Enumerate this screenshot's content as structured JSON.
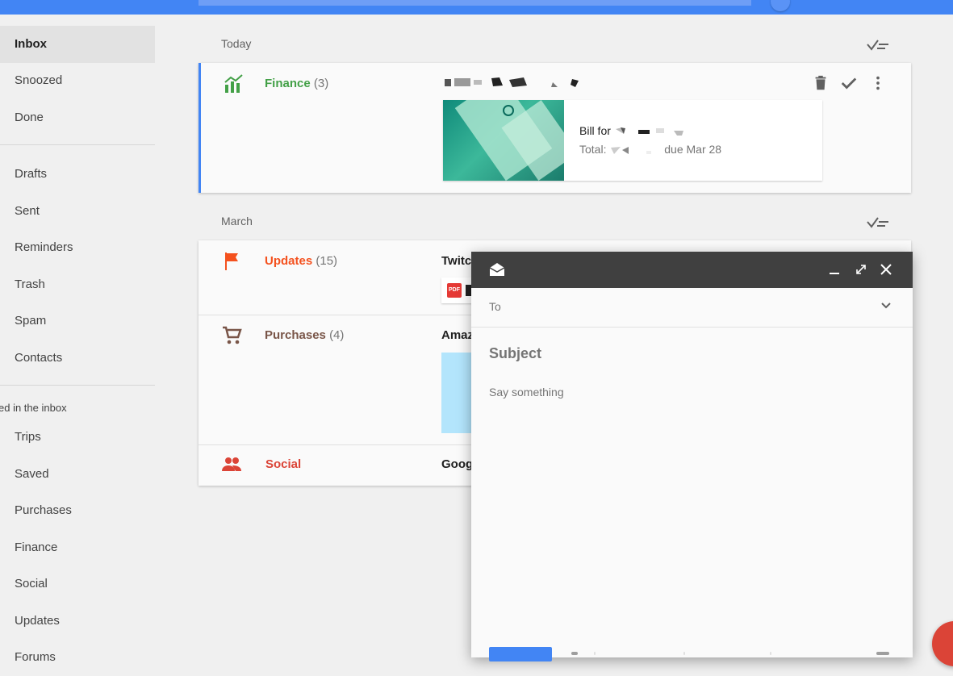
{
  "sidebar": {
    "primary": [
      "Inbox",
      "Snoozed",
      "Done"
    ],
    "secondary": [
      "Drafts",
      "Sent",
      "Reminders",
      "Trash",
      "Spam",
      "Contacts"
    ],
    "group_label": "ed in the inbox",
    "groups": [
      "Trips",
      "Saved",
      "Purchases",
      "Finance",
      "Social",
      "Updates",
      "Forums"
    ]
  },
  "sections": {
    "today": "Today",
    "march": "March"
  },
  "finance": {
    "name": "Finance",
    "count": "(3)",
    "color": "#43a047",
    "bill_line1": "Bill for",
    "bill_line2_prefix": "Total:",
    "bill_line2_suffix": "due Mar 28"
  },
  "bundles": [
    {
      "name": "Updates",
      "count": "(15)",
      "color": "#f4511e",
      "sender": "Twitc"
    },
    {
      "name": "Purchases",
      "count": "(4)",
      "color": "#795548",
      "sender": "Amaz"
    },
    {
      "name": "Social",
      "count": "",
      "color": "#db4437",
      "sender": "Goog"
    }
  ],
  "compose": {
    "to_label": "To",
    "subject_placeholder": "Subject",
    "body_placeholder": "Say something"
  },
  "colors": {
    "accent": "#4285f4",
    "finance": "#43a047",
    "updates": "#f4511e",
    "purchases": "#795548",
    "social": "#db4437"
  },
  "icons": {
    "sweep": "sweep-icon",
    "delete": "trash-icon",
    "done": "check-icon",
    "more": "more-vert-icon",
    "compose": "compose-envelope-icon",
    "minimize": "minimize-icon",
    "expand": "expand-icon",
    "close": "close-icon",
    "dropdown": "chevron-down-icon"
  }
}
